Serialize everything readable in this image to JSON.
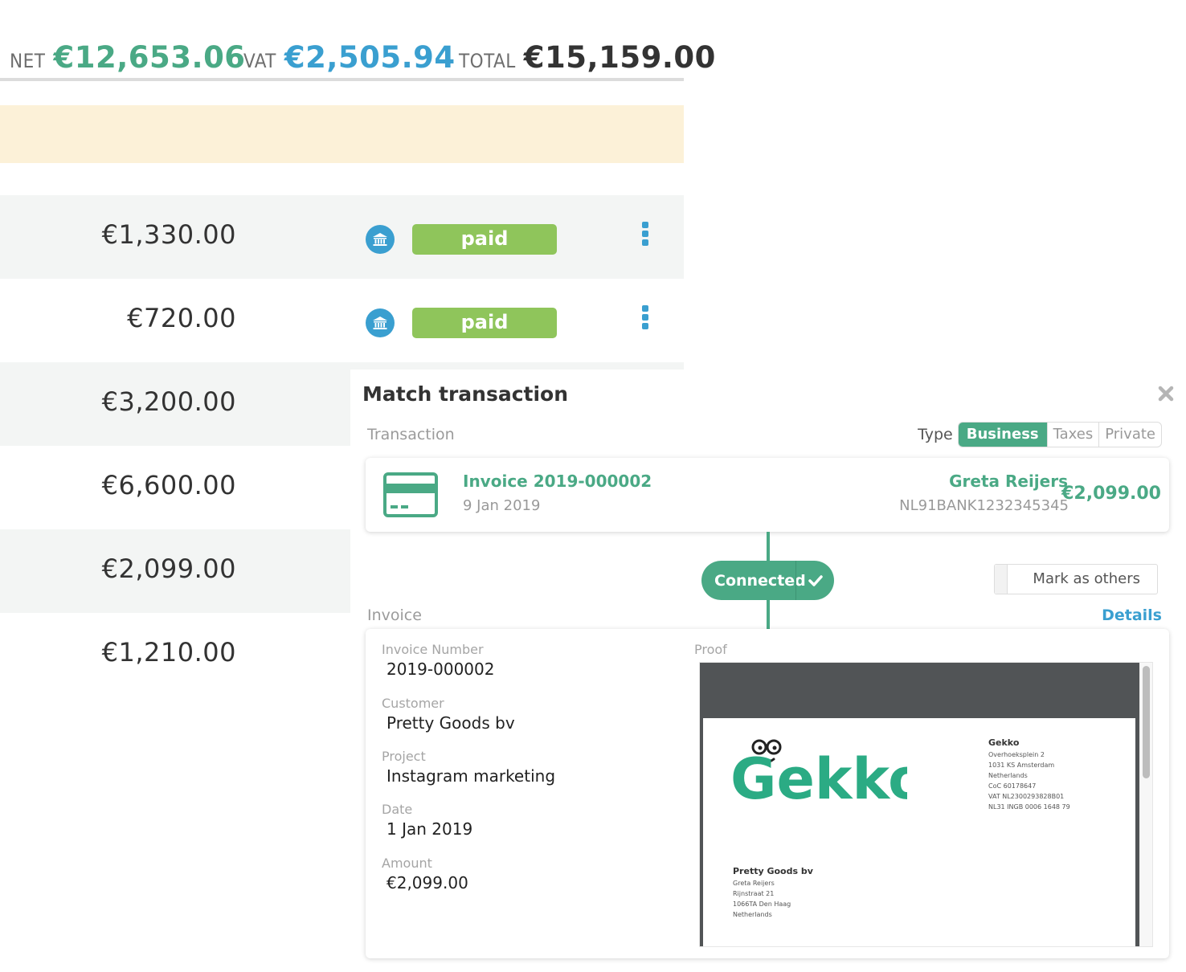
{
  "totals": {
    "net": {
      "label": "NET",
      "value": "€12,653.06"
    },
    "vat": {
      "label": "VAT",
      "value": "€2,505.94"
    },
    "total": {
      "label": "TOTAL",
      "value": "€15,159.00"
    }
  },
  "colors": {
    "green": "#4aa985",
    "blue": "#3a9fd0",
    "paid": "#8fc55b",
    "notice": "#fcf1d8",
    "row_alt": "#f3f5f4"
  },
  "rows": [
    {
      "amount": "€1,330.00",
      "status": "paid",
      "icon": "bank-icon"
    },
    {
      "amount": "€720.00",
      "status": "paid",
      "icon": "bank-icon"
    },
    {
      "amount": "€3,200.00"
    },
    {
      "amount": "€6,600.00"
    },
    {
      "amount": "€2,099.00"
    },
    {
      "amount": "€1,210.00"
    }
  ],
  "panel": {
    "title": "Match transaction",
    "close_icon": "close-icon",
    "transaction_label": "Transaction",
    "type_label": "Type",
    "type_options": [
      "Business",
      "Taxes",
      "Private"
    ],
    "type_selected": "Business",
    "transaction": {
      "title": "Invoice 2019-000002",
      "date": "9 Jan 2019",
      "party": "Greta Reijers",
      "iban": "NL91BANK1232345345",
      "amount": "€2,099.00",
      "icon": "credit-card-icon"
    },
    "connected_label": "Connected",
    "mark_as_others_label": "Mark as others",
    "invoice_label": "Invoice",
    "details_label": "Details",
    "invoice": {
      "fields": [
        {
          "label": "Invoice Number",
          "value": "2019-000002"
        },
        {
          "label": "Customer",
          "value": "Pretty Goods bv"
        },
        {
          "label": "Project",
          "value": "Instagram marketing"
        },
        {
          "label": "Date",
          "value": "1 Jan 2019"
        },
        {
          "label": "Amount",
          "value": "€2,099.00"
        }
      ],
      "proof_label": "Proof",
      "proof": {
        "logo_text": "Gekko",
        "company": {
          "name": "Gekko",
          "lines": [
            "Overhoeksplein 2",
            "1031 KS Amsterdam",
            "Netherlands",
            "CoC 60178647",
            "VAT NL2300293828B01",
            "NL31 INGB 0006 1648 79"
          ]
        },
        "customer": {
          "name": "Pretty Goods bv",
          "lines": [
            "Greta Reijers",
            "Rijnstraat 21",
            "1066TA Den Haag",
            "Netherlands"
          ]
        }
      }
    }
  }
}
